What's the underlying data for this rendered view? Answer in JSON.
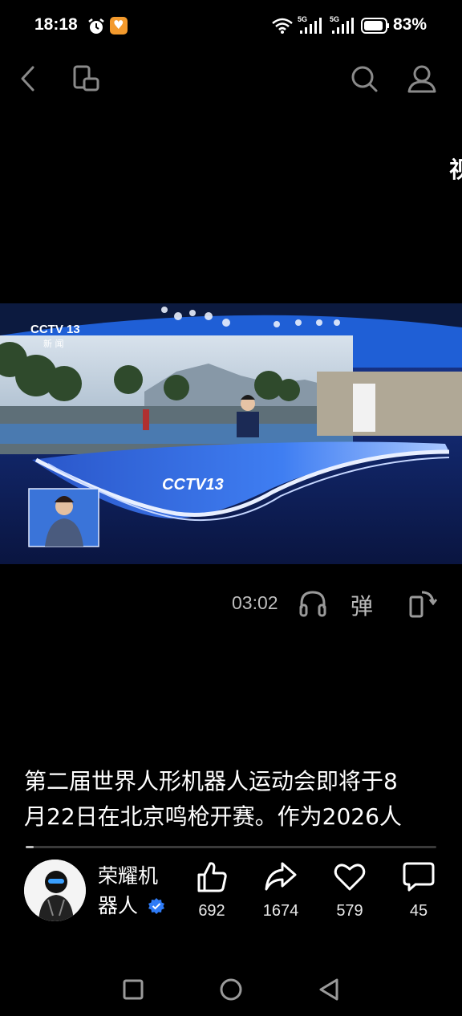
{
  "status_bar": {
    "time": "18:18",
    "network_1": "5G",
    "network_2": "5G",
    "battery_percent": "83%",
    "icons": [
      "alarm-icon",
      "app-notification-icon",
      "wifi-icon",
      "signal-icon",
      "signal-icon",
      "battery-icon"
    ]
  },
  "top_bar": {
    "icons": [
      "back-icon",
      "window-switch-icon",
      "search-icon",
      "user-icon"
    ]
  },
  "side_text": "视",
  "video": {
    "channel_logo": "CCTV 13",
    "channel_sublabel": "新 闻",
    "desk_logo": "CCTV13",
    "colors": {
      "studio_blue": "#1f5fd6",
      "desk_glow": "#d8e6ff"
    }
  },
  "player_controls": {
    "duration": "03:02",
    "danmaku_label": "弹",
    "icons": [
      "headphones-icon",
      "danmaku-icon",
      "rotate-screen-icon"
    ]
  },
  "caption": {
    "line1": "第二届世界人形机器人运动会即将于8",
    "line2": "月22日在北京鸣枪开赛。作为2026人"
  },
  "progress": {
    "played_fraction": 0.02
  },
  "author": {
    "name_line1": "荣耀机",
    "name_line2": "器人",
    "verified": true
  },
  "actions": {
    "like": {
      "count": "692",
      "icon": "like-icon"
    },
    "share": {
      "count": "1674",
      "icon": "share-icon"
    },
    "favorite": {
      "count": "579",
      "icon": "heart-icon"
    },
    "comment": {
      "count": "45",
      "icon": "comment-icon"
    }
  },
  "nav_bar": {
    "icons": [
      "recent-apps-icon",
      "home-icon",
      "back-nav-icon"
    ]
  },
  "colors": {
    "background": "#000000",
    "verified_badge": "#2e7bf6",
    "secondary_text": "#bdbdbd"
  }
}
